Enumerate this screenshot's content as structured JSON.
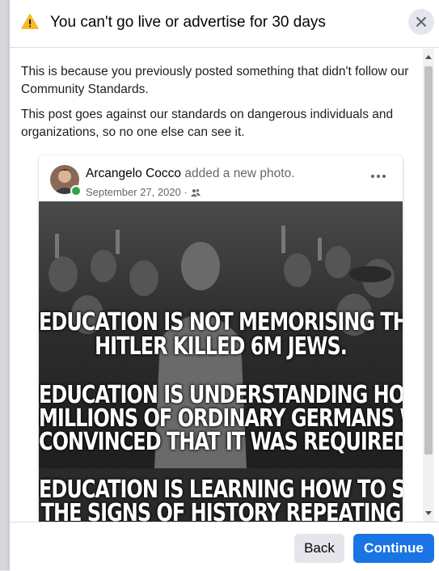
{
  "dialog": {
    "title": "You can't go live or advertise for 30 days",
    "paragraph_1": "This is because you previously posted something that didn't follow our Community Standards.",
    "paragraph_2": "This post goes against our standards on dangerous individuals and organizations, so no one else can see it."
  },
  "post": {
    "author": "Arcangelo Cocco",
    "action": " added a new photo.",
    "date": "September 27, 2020 ·",
    "audience_icon": "friends-icon",
    "image_text": [
      "EDUCATION IS NOT MEMORISING THAT",
      "HITLER KILLED 6M JEWS.",
      "EDUCATION IS UNDERSTANDING HOW",
      "MILLIONS OF ORDINARY GERMANS WERE",
      "CONVINCED THAT IT WAS REQUIRED.",
      "EDUCATION IS LEARNING HOW TO SPOT",
      "THE SIGNS OF HISTORY REPEATING"
    ]
  },
  "footer": {
    "back_label": "Back",
    "continue_label": "Continue"
  },
  "colors": {
    "accent": "#1b74e4",
    "warning": "#f7b928",
    "online": "#31a24c"
  }
}
